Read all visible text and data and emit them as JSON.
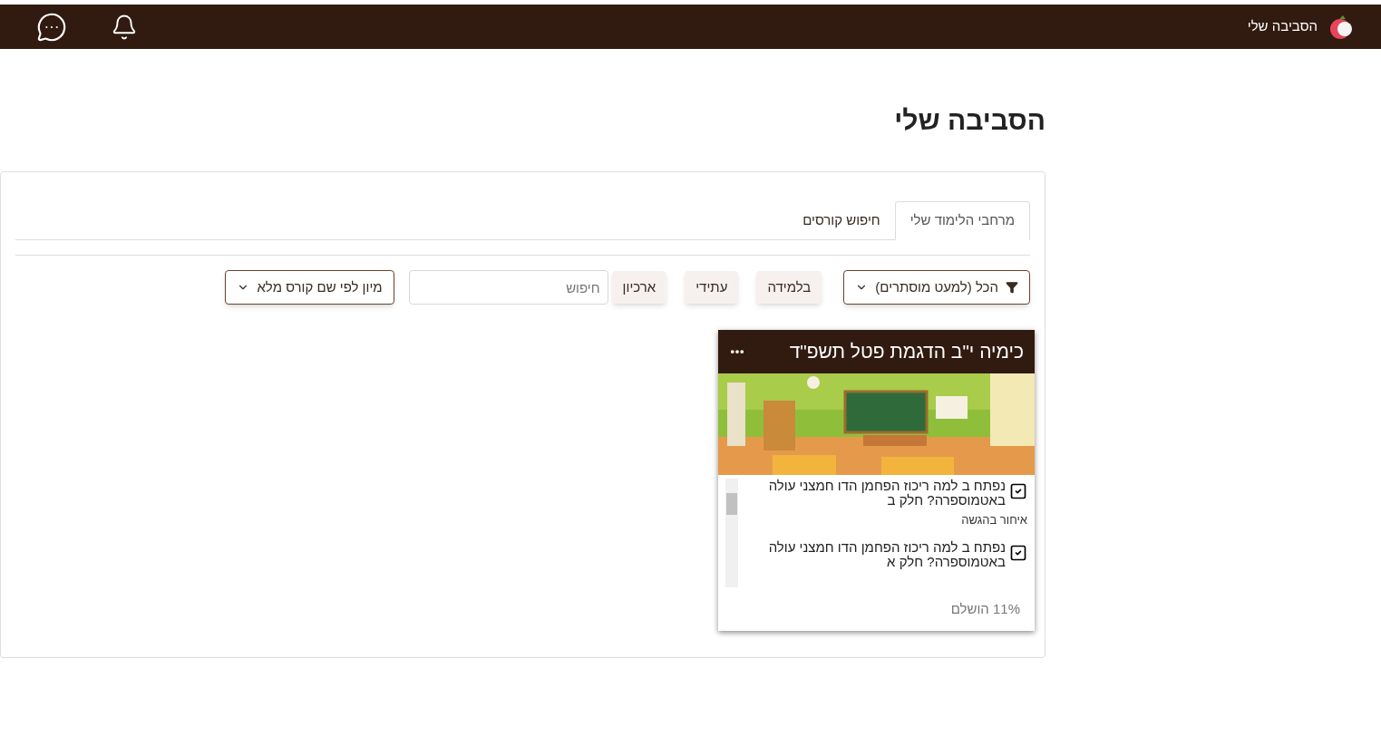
{
  "navbar": {
    "site_title": "הסביבה שלי"
  },
  "page": {
    "title": "הסביבה שלי"
  },
  "tabs": [
    {
      "label": "מרחבי הלימוד שלי",
      "selected": true
    },
    {
      "label": "חיפוש קורסים",
      "selected": false
    }
  ],
  "filters": [
    {
      "kind": "dropdown",
      "label": "הכל (למעט מוסתרים)"
    },
    {
      "kind": "toggle",
      "label": "בלמידה"
    },
    {
      "kind": "toggle",
      "label": "עתידי"
    },
    {
      "kind": "toggle",
      "label": "ארכיון"
    },
    {
      "kind": "search",
      "placeholder": "חיפוש"
    },
    {
      "kind": "dropdown",
      "label": "מיון לפי שם קורס מלא"
    }
  ],
  "courses": [
    {
      "title": "כימיה י\"ב הדגמת פטל תשפ\"ד",
      "activities": [
        {
          "name": "נפתח ב למה ריכוז הפחמן הדו חמצני עולה באטמוספרה? חלק ב",
          "status": "איחור בהגשה"
        },
        {
          "name": "נפתח ב למה ריכוז הפחמן הדו חמצני עולה באטמוספרה? חלק א"
        }
      ],
      "progress": "11% הושלם"
    }
  ]
}
